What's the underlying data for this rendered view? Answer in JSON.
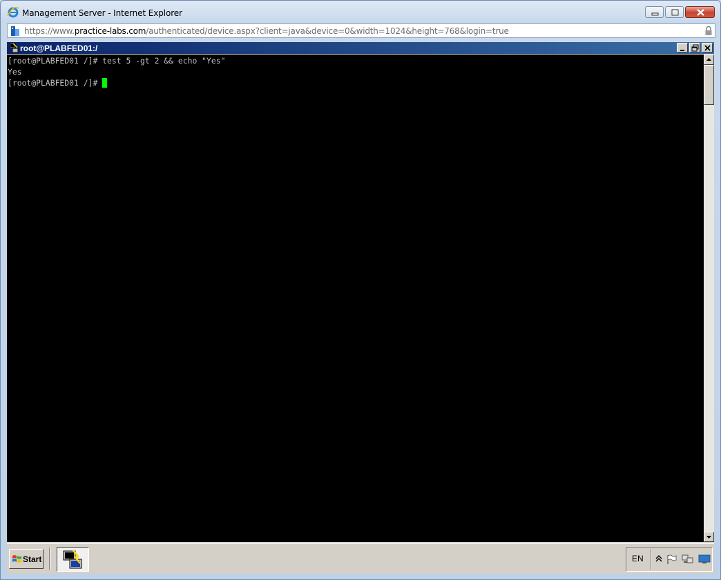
{
  "browser": {
    "title": "Management Server - Internet Explorer",
    "url_scheme": "https://www.",
    "url_host": "practice-labs.com",
    "url_path": "/authenticated/device.aspx?client=java&device=0&width=1024&height=768&login=true"
  },
  "putty": {
    "title": "root@PLABFED01:/"
  },
  "terminal": {
    "lines": [
      "[root@PLABFED01 /]# test 5 -gt 2 && echo \"Yes\"",
      "Yes",
      "[root@PLABFED01 /]# "
    ],
    "cursor_color": "#00ff00"
  },
  "taskbar": {
    "start_label": "Start",
    "language": "EN"
  }
}
